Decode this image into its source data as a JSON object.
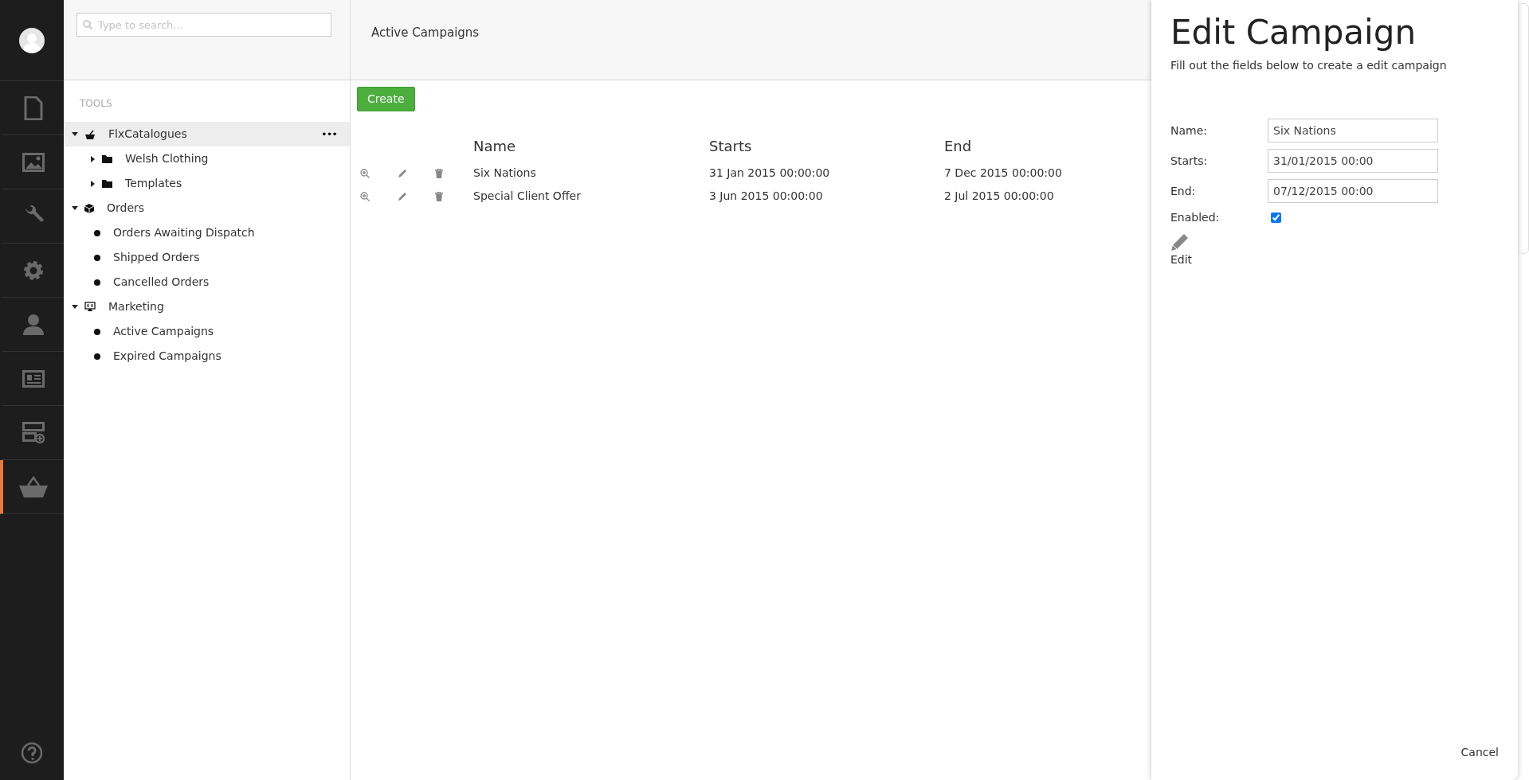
{
  "nav": {
    "items": [
      {
        "selected": false
      },
      {
        "selected": false
      },
      {
        "selected": false
      },
      {
        "selected": false
      },
      {
        "selected": false
      },
      {
        "selected": false
      },
      {
        "selected": false
      },
      {
        "selected": true
      }
    ]
  },
  "tree_panel": {
    "search": {
      "placeholder": "Type to search..."
    },
    "heading": "TOOLS",
    "items": [
      {
        "label": "FlxCatalogues",
        "kind": "group",
        "expanded": true,
        "selected": true,
        "menu": "•••",
        "children": [
          {
            "label": "Welsh Clothing",
            "kind": "folder",
            "expanded": false,
            "selected": false
          },
          {
            "label": "Templates",
            "kind": "folder",
            "expanded": false,
            "selected": false
          }
        ]
      },
      {
        "label": "Orders",
        "kind": "group",
        "expanded": true,
        "selected": false,
        "children": [
          {
            "label": "Orders Awaiting Dispatch",
            "kind": "leaf",
            "selected": false
          },
          {
            "label": "Shipped Orders",
            "kind": "leaf",
            "selected": false
          },
          {
            "label": "Cancelled Orders",
            "kind": "leaf",
            "selected": false
          }
        ]
      },
      {
        "label": "Marketing",
        "kind": "group",
        "expanded": true,
        "selected": false,
        "children": [
          {
            "label": "Active Campaigns",
            "kind": "leaf",
            "selected": false
          },
          {
            "label": "Expired Campaigns",
            "kind": "leaf",
            "selected": false
          }
        ]
      }
    ]
  },
  "main": {
    "title": "Active Campaigns",
    "create_button": "Create",
    "table": {
      "columns": [
        "Name",
        "Starts",
        "End"
      ],
      "rows": [
        {
          "name": "Six Nations",
          "starts": "31 Jan 2015 00:00:00",
          "end": "7 Dec 2015 00:00:00"
        },
        {
          "name": "Special Client Offer",
          "starts": "3 Jun 2015 00:00:00",
          "end": "2 Jul 2015 00:00:00"
        }
      ]
    }
  },
  "edit_panel": {
    "title": "Edit Campaign",
    "subtitle": "Fill out the fields below to create a edit campaign",
    "fields": [
      {
        "label": "Name:",
        "kind": "text",
        "value": "Six Nations"
      },
      {
        "label": "Starts:",
        "kind": "text",
        "value": "31/01/2015 00:00"
      },
      {
        "label": "End:",
        "kind": "text",
        "value": "07/12/2015 00:00"
      },
      {
        "label": "Enabled:",
        "kind": "checkbox",
        "checked": true
      }
    ],
    "edit_button": "Edit",
    "cancel_button": "Cancel"
  }
}
